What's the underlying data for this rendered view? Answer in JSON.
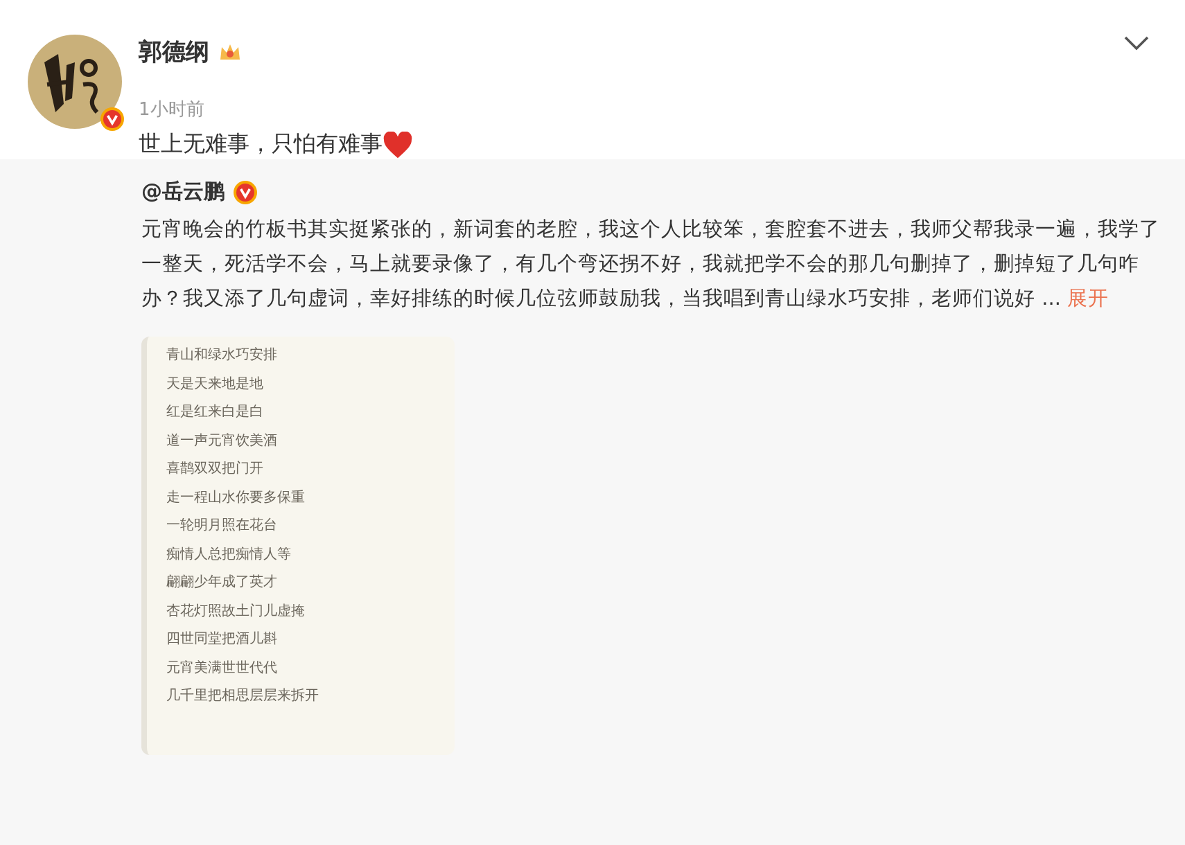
{
  "post": {
    "author": "郭德纲",
    "time": "1小时前",
    "text": "世上无难事，只怕有难事"
  },
  "repost": {
    "author": "@岳云鹏",
    "text": "元宵晚会的竹板书其实挺紧张的，新词套的老腔，我这个人比较笨，套腔套不进去，我师父帮我录一遍，我学了一整天，死活学不会，马上就要录像了，有几个弯还拐不好，我就把学不会的那几句删掉了，删掉短了几句咋办？我又添了几句虚词，幸好排练的时候几位弦师鼓励我，当我唱到青山绿水巧安排，老师们说好",
    "ellipsis": "...",
    "expand": "展开",
    "document_lines": [
      "青山和绿水巧安排",
      "天是天来地是地",
      "红是红来白是白",
      "道一声元宵饮美酒",
      "喜鹊双双把门开",
      "走一程山水你要多保重",
      "一轮明月照在花台",
      "痴情人总把痴情人等",
      "翩翩少年成了英才",
      "杏花灯照故土门儿虚掩",
      "四世同堂把酒儿斟",
      "元宵美满世世代代",
      "几千里把相思层层来拆开"
    ]
  }
}
